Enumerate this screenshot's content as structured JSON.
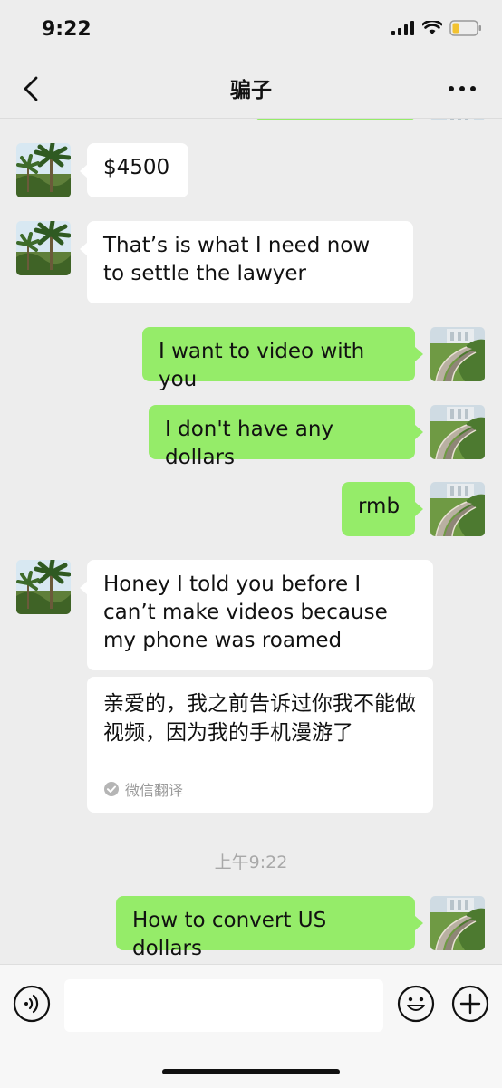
{
  "status_bar": {
    "time": "9:22"
  },
  "header": {
    "title": "骗子"
  },
  "messages": [
    {
      "side": "left",
      "text": "$4500"
    },
    {
      "side": "left",
      "text": "That’s is what I need now to settle the lawyer"
    },
    {
      "side": "right",
      "text": "I want to video with you"
    },
    {
      "side": "right",
      "text": "I don't have any dollars"
    },
    {
      "side": "right",
      "text": "rmb"
    },
    {
      "side": "left",
      "text": "Honey I told you before I can’t make videos because my phone was roamed"
    },
    {
      "side": "right",
      "text": "How to convert US dollars"
    }
  ],
  "translation": {
    "text": "亲爱的，我之前告诉过你我不能做视频，因为我的手机漫游了",
    "badge": "微信翻译"
  },
  "time_divider": "上午9:22",
  "input": {
    "value": "",
    "placeholder": ""
  },
  "icons": {
    "back": "chevron-left-icon",
    "more": "more-dots-icon",
    "voice": "voice-icon",
    "emoji": "emoji-icon",
    "plus": "plus-icon",
    "check": "check-circle-icon"
  },
  "colors": {
    "background": "#ededed",
    "bubble_sent": "#95ec69",
    "bubble_received": "#ffffff",
    "meta_text": "#a8a8a8"
  }
}
